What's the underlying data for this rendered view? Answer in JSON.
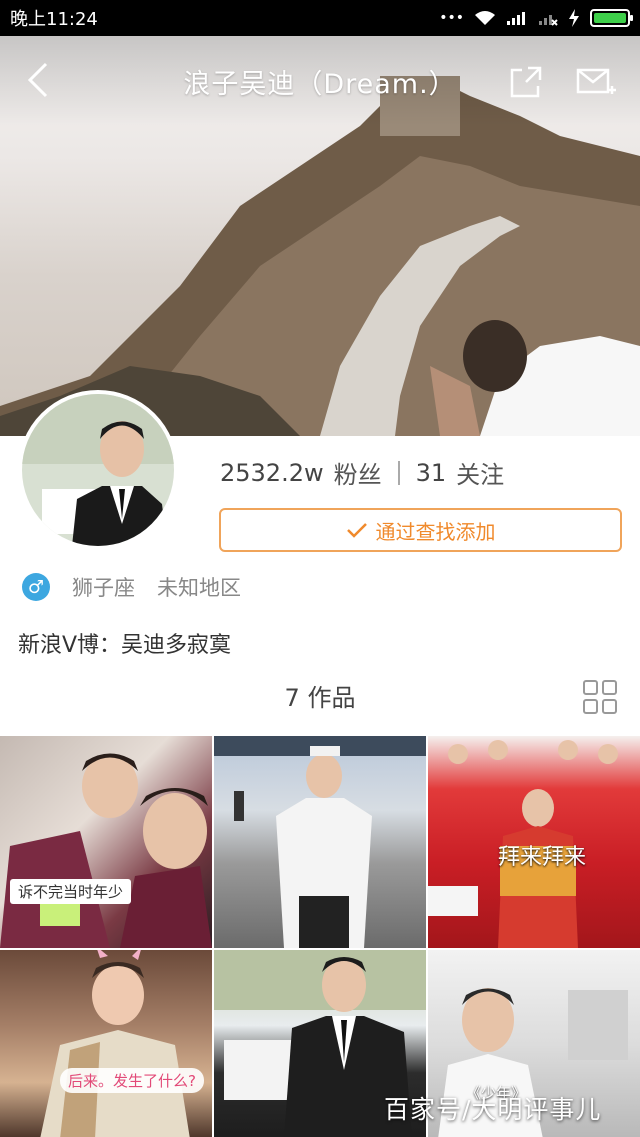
{
  "status_bar": {
    "time": "晚上11:24",
    "dots": "•••",
    "battery_level": 1.0
  },
  "nav": {
    "title": "浪子吴迪（Dream.）",
    "back_icon": "chevron-left-icon",
    "share_icon": "share-icon",
    "message_icon": "mail-icon"
  },
  "profile": {
    "fans_count": "2532.2w",
    "fans_label": "粉丝",
    "follow_count": "31",
    "follow_label": "关注",
    "add_button": "通过查找添加",
    "gender_symbol": "♂",
    "zodiac": "狮子座",
    "location": "未知地区",
    "verify_text": "新浪V博：吴迪多寂寞"
  },
  "works": {
    "count_label": "7 作品",
    "grid_icon": "grid-view-icon"
  },
  "thumbnails": [
    {
      "caption": "诉不完当时年少"
    },
    {
      "caption": ""
    },
    {
      "caption": "拜来拜来"
    },
    {
      "caption": "后来。发生了什么?"
    },
    {
      "caption": ""
    },
    {
      "caption": "《少年》"
    }
  ],
  "watermark": "百家号/大明评事儿"
}
